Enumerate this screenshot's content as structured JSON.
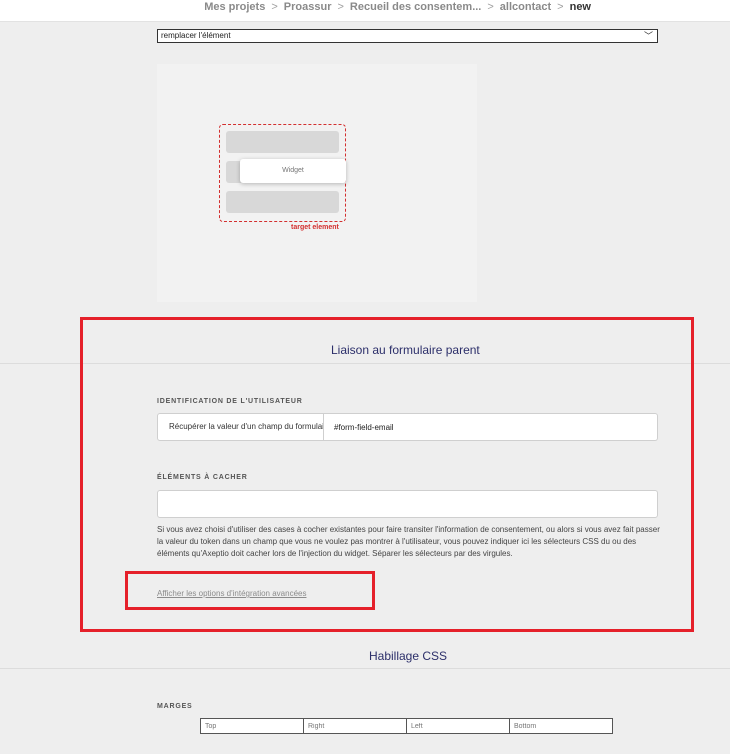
{
  "breadcrumb": {
    "items": [
      "Mes projets",
      "Proassur",
      "Recueil des consentem...",
      "allcontact",
      "new"
    ],
    "separator": ">"
  },
  "placement": {
    "selected": "remplacer l'élément"
  },
  "preview": {
    "widget_label": "Widget",
    "target_label": "target element"
  },
  "parent_form": {
    "title": "Liaison au formulaire parent",
    "user_id": {
      "label": "IDENTIFICATION DE L'UTILISATEUR",
      "method": "Récupérer la valeur d'un champ du formulaire",
      "value": "#form-field-email"
    },
    "hide": {
      "label": "ÉLÉMENTS À CACHER",
      "value": "",
      "help": "Si vous avez choisi d'utiliser des cases à cocher existantes pour faire transiter l'information de consentement, ou alors si vous avez fait passer la valeur du token dans un champ que vous ne voulez pas montrer à l'utilisateur, vous pouvez indiquer ici les sélecteurs CSS du ou des éléments qu'Axeptio doit cacher lors de l'injection du widget. Séparer les sélecteurs par des virgules."
    },
    "advanced_link": "Afficher les options d'intégration avancées"
  },
  "css_skin": {
    "title": "Habillage CSS",
    "margins": {
      "label": "MARGES",
      "placeholders": [
        "Top",
        "Right",
        "Left",
        "Bottom"
      ]
    }
  },
  "colors": {
    "accent_title": "#2c2f6a",
    "highlight": "#e5202a",
    "target": "#d32f2f"
  }
}
